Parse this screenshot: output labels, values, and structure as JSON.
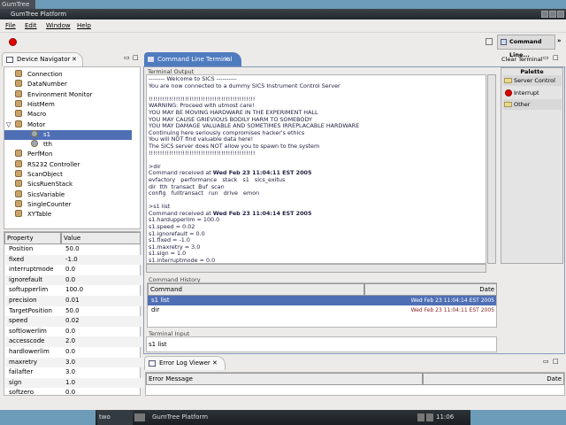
{
  "desktop": {
    "top_tab": "GumTree Pla"
  },
  "window": {
    "title": "GumTree Platform"
  },
  "menu": [
    "File",
    "Edit",
    "Window",
    "Help"
  ],
  "toolbar": {
    "perspective_label": "Command Line...",
    "more": "»"
  },
  "navigator": {
    "title": "Device Navigator",
    "items": [
      {
        "label": "Connection",
        "level": 0
      },
      {
        "label": "DataNumber",
        "level": 0
      },
      {
        "label": "Environment Monitor",
        "level": 0
      },
      {
        "label": "HistMem",
        "level": 0
      },
      {
        "label": "Macro",
        "level": 0
      },
      {
        "label": "Motor",
        "level": 0,
        "expanded": true
      },
      {
        "label": "s1",
        "level": 1,
        "selected": true
      },
      {
        "label": "tth",
        "level": 1
      },
      {
        "label": "PerfMon",
        "level": 0
      },
      {
        "label": "RS232 Controller",
        "level": 0
      },
      {
        "label": "ScanObject",
        "level": 0
      },
      {
        "label": "SicsRuenStack",
        "level": 0
      },
      {
        "label": "SicsVariable",
        "level": 0
      },
      {
        "label": "SingleCounter",
        "level": 0
      },
      {
        "label": "XYTable",
        "level": 0
      }
    ]
  },
  "properties": {
    "headers": [
      "Property",
      "Value"
    ],
    "rows": [
      [
        "Position",
        "50.0"
      ],
      [
        "fixed",
        "-1.0"
      ],
      [
        "interruptmode",
        "0.0"
      ],
      [
        "ignorefault",
        "0.0"
      ],
      [
        "softupperlim",
        "100.0"
      ],
      [
        "precision",
        "0.01"
      ],
      [
        "TargetPosition",
        "50.0"
      ],
      [
        "speed",
        "0.02"
      ],
      [
        "softlowerlim",
        "0.0"
      ],
      [
        "accesscode",
        "2.0"
      ],
      [
        "hardlowerlim",
        "0.0"
      ],
      [
        "maxretry",
        "3.0"
      ],
      [
        "failafter",
        "3.0"
      ],
      [
        "sign",
        "1.0"
      ],
      [
        "softzero",
        "0.0"
      ]
    ]
  },
  "terminal": {
    "tab_title": "Command Line Terminal",
    "clear_label": "Clear Terminal",
    "output_label": "Terminal Output",
    "lines": [
      {
        "t": "-------- Welcome to SICS ----------"
      },
      {
        "t": "You are now connected to a dummy SICS Instrument Control Server"
      },
      {
        "t": ""
      },
      {
        "t": "!!!!!!!!!!!!!!!!!!!!!!!!!!!!!!!!!!!!!!!!!!!!!!!"
      },
      {
        "t": "WARNING: Proceed with utmost care!"
      },
      {
        "t": "YOU MAY BE MOVING HARDWARE IN THE EXPERIMENT HALL"
      },
      {
        "t": "YOU MAY CAUSE GRIEVIOUS BODILY HARM TO SOMEBODY"
      },
      {
        "t": "YOU MAY DAMAGE VALUABLE AND SOMETIMES IRREPLACABLE HARDWARE"
      },
      {
        "t": "Continuing here seriously compromises hacker's ethics"
      },
      {
        "t": "You will NOT find valuable data here!"
      },
      {
        "t": "The SICS server does NOT allow you to spawn to the system"
      },
      {
        "t": "!!!!!!!!!!!!!!!!!!!!!!!!!!!!!!!!!!!!!!!!!!!!!!!"
      },
      {
        "t": ""
      },
      {
        "t": ">dir"
      },
      {
        "t": "Command received at ",
        "bold": "Wed Feb 23 11:04:11 EST 2005"
      },
      {
        "t": "evfactory   performance   stack   s1   sics_exitus"
      },
      {
        "t": "dir  tth  transact  Buf  scan"
      },
      {
        "t": "config   fulltransact   run   drive   emon"
      },
      {
        "t": ""
      },
      {
        "t": ">s1 list"
      },
      {
        "t": "Command received at ",
        "bold": "Wed Feb 23 11:04:14 EST 2005"
      },
      {
        "t": "s1.hardupperlim = 100.0"
      },
      {
        "t": "s1.speed = 0.02"
      },
      {
        "t": "s1.ignorefault = 0.0"
      },
      {
        "t": "s1.fixed = -1.0"
      },
      {
        "t": "s1.maxretry = 3.0"
      },
      {
        "t": "s1.sign = 1.0"
      },
      {
        "t": "s1.interruptmode = 0.0"
      }
    ],
    "history_label": "Command History",
    "history_headers": [
      "Command",
      "Date"
    ],
    "history": [
      [
        "s1 list",
        "Wed Feb 23 11:04:14 EST 2005"
      ],
      [
        "dir",
        "Wed Feb 23 11:04:11 EST 2005"
      ]
    ],
    "input_label": "Terminal Input",
    "input_value": "s1 list"
  },
  "palette": {
    "title": "Palette",
    "items": [
      "Server Control",
      "Interrupt",
      "Other"
    ]
  },
  "errorlog": {
    "title": "Error Log Viewer",
    "headers": [
      "Error Message",
      "Date"
    ]
  },
  "taskbar": {
    "workspace": "two",
    "app": "GumTree Platform",
    "clock": "11:06"
  }
}
